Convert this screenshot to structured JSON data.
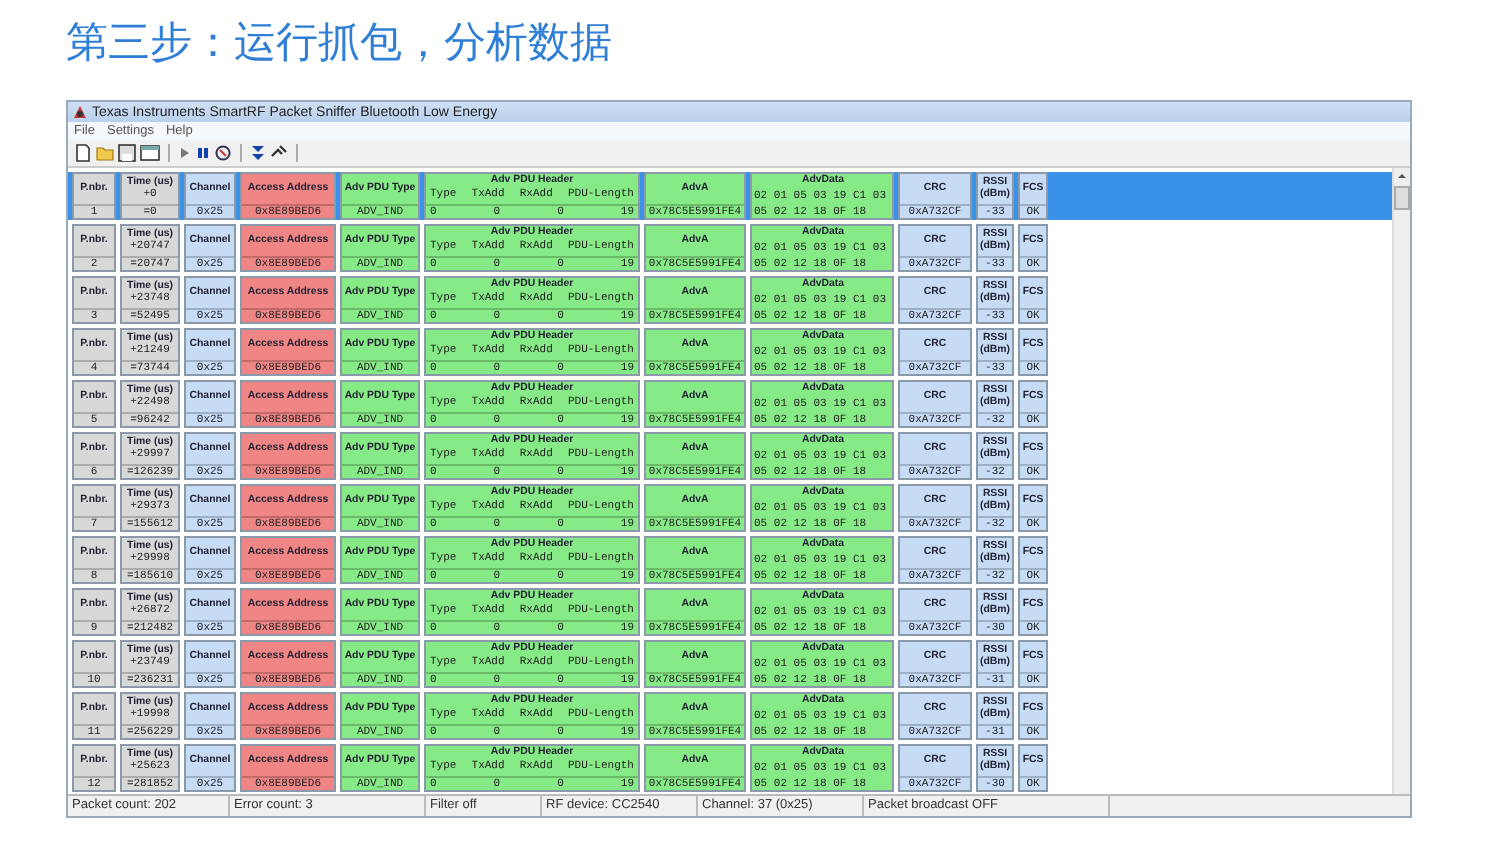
{
  "heading": "第三步：运行抓包，分析数据",
  "window": {
    "title": "Texas Instruments SmartRF Packet Sniffer Bluetooth Low Energy"
  },
  "menu": [
    "File",
    "Settings",
    "Help"
  ],
  "packets": [
    {
      "selected": true,
      "cells": [
        {
          "kind": "meta",
          "header": "P.nbr.",
          "values": [
            "1"
          ]
        },
        {
          "kind": "meta",
          "header": "Time (us)",
          "values": [
            "+0",
            "=0"
          ]
        },
        {
          "kind": "field",
          "header": "Channel",
          "values": [
            "0x25"
          ]
        },
        {
          "kind": "access",
          "header": "Access Address",
          "values": [
            "0x8E89BED6"
          ]
        },
        {
          "kind": "pdu",
          "header": "Adv PDU Type",
          "values": [
            "ADV_IND"
          ]
        },
        {
          "kind": "pdu_table",
          "header": "Adv PDU Header",
          "labels": [
            "Type",
            "TxAdd",
            "RxAdd",
            "PDU-Length"
          ],
          "values": [
            "0",
            "0",
            "0",
            "19"
          ]
        },
        {
          "kind": "pdu",
          "header": "AdvA",
          "values": [
            "0x78C5E5991FE4"
          ]
        },
        {
          "kind": "pdu_block",
          "header": "AdvData",
          "values": [
            "02 01 05 03 19 C1 03",
            "05 02 12 18 0F 18"
          ]
        },
        {
          "kind": "field",
          "header": "CRC",
          "values": [
            "0xA732CF"
          ]
        },
        {
          "kind": "field",
          "header": "RSSI (dBm)",
          "values": [
            "-33"
          ]
        },
        {
          "kind": "field",
          "header": "FCS",
          "values": [
            "OK"
          ]
        }
      ]
    },
    {
      "selected": false,
      "cells": [
        {
          "kind": "meta",
          "header": "P.nbr.",
          "values": [
            "2"
          ]
        },
        {
          "kind": "meta",
          "header": "Time (us)",
          "values": [
            "+20747",
            "=20747"
          ]
        },
        {
          "kind": "field",
          "header": "Channel",
          "values": [
            "0x25"
          ]
        },
        {
          "kind": "access",
          "header": "Access Address",
          "values": [
            "0x8E89BED6"
          ]
        },
        {
          "kind": "pdu",
          "header": "Adv PDU Type",
          "values": [
            "ADV_IND"
          ]
        },
        {
          "kind": "pdu_table",
          "header": "Adv PDU Header",
          "labels": [
            "Type",
            "TxAdd",
            "RxAdd",
            "PDU-Length"
          ],
          "values": [
            "0",
            "0",
            "0",
            "19"
          ]
        },
        {
          "kind": "pdu",
          "header": "AdvA",
          "values": [
            "0x78C5E5991FE4"
          ]
        },
        {
          "kind": "pdu_block",
          "header": "AdvData",
          "values": [
            "02 01 05 03 19 C1 03",
            "05 02 12 18 0F 18"
          ]
        },
        {
          "kind": "field",
          "header": "CRC",
          "values": [
            "0xA732CF"
          ]
        },
        {
          "kind": "field",
          "header": "RSSI (dBm)",
          "values": [
            "-33"
          ]
        },
        {
          "kind": "field",
          "header": "FCS",
          "values": [
            "OK"
          ]
        }
      ]
    },
    {
      "selected": false,
      "cells": [
        {
          "kind": "meta",
          "header": "P.nbr.",
          "values": [
            "3"
          ]
        },
        {
          "kind": "meta",
          "header": "Time (us)",
          "values": [
            "+23748",
            "=52495"
          ]
        },
        {
          "kind": "field",
          "header": "Channel",
          "values": [
            "0x25"
          ]
        },
        {
          "kind": "access",
          "header": "Access Address",
          "values": [
            "0x8E89BED6"
          ]
        },
        {
          "kind": "pdu",
          "header": "Adv PDU Type",
          "values": [
            "ADV_IND"
          ]
        },
        {
          "kind": "pdu_table",
          "header": "Adv PDU Header",
          "labels": [
            "Type",
            "TxAdd",
            "RxAdd",
            "PDU-Length"
          ],
          "values": [
            "0",
            "0",
            "0",
            "19"
          ]
        },
        {
          "kind": "pdu",
          "header": "AdvA",
          "values": [
            "0x78C5E5991FE4"
          ]
        },
        {
          "kind": "pdu_block",
          "header": "AdvData",
          "values": [
            "02 01 05 03 19 C1 03",
            "05 02 12 18 0F 18"
          ]
        },
        {
          "kind": "field",
          "header": "CRC",
          "values": [
            "0xA732CF"
          ]
        },
        {
          "kind": "field",
          "header": "RSSI (dBm)",
          "values": [
            "-33"
          ]
        },
        {
          "kind": "field",
          "header": "FCS",
          "values": [
            "OK"
          ]
        }
      ]
    },
    {
      "selected": false,
      "cells": [
        {
          "kind": "meta",
          "header": "P.nbr.",
          "values": [
            "4"
          ]
        },
        {
          "kind": "meta",
          "header": "Time (us)",
          "values": [
            "+21249",
            "=73744"
          ]
        },
        {
          "kind": "field",
          "header": "Channel",
          "values": [
            "0x25"
          ]
        },
        {
          "kind": "access",
          "header": "Access Address",
          "values": [
            "0x8E89BED6"
          ]
        },
        {
          "kind": "pdu",
          "header": "Adv PDU Type",
          "values": [
            "ADV_IND"
          ]
        },
        {
          "kind": "pdu_table",
          "header": "Adv PDU Header",
          "labels": [
            "Type",
            "TxAdd",
            "RxAdd",
            "PDU-Length"
          ],
          "values": [
            "0",
            "0",
            "0",
            "19"
          ]
        },
        {
          "kind": "pdu",
          "header": "AdvA",
          "values": [
            "0x78C5E5991FE4"
          ]
        },
        {
          "kind": "pdu_block",
          "header": "AdvData",
          "values": [
            "02 01 05 03 19 C1 03",
            "05 02 12 18 0F 18"
          ]
        },
        {
          "kind": "field",
          "header": "CRC",
          "values": [
            "0xA732CF"
          ]
        },
        {
          "kind": "field",
          "header": "RSSI (dBm)",
          "values": [
            "-33"
          ]
        },
        {
          "kind": "field",
          "header": "FCS",
          "values": [
            "OK"
          ]
        }
      ]
    },
    {
      "selected": false,
      "cells": [
        {
          "kind": "meta",
          "header": "P.nbr.",
          "values": [
            "5"
          ]
        },
        {
          "kind": "meta",
          "header": "Time (us)",
          "values": [
            "+22498",
            "=96242"
          ]
        },
        {
          "kind": "field",
          "header": "Channel",
          "values": [
            "0x25"
          ]
        },
        {
          "kind": "access",
          "header": "Access Address",
          "values": [
            "0x8E89BED6"
          ]
        },
        {
          "kind": "pdu",
          "header": "Adv PDU Type",
          "values": [
            "ADV_IND"
          ]
        },
        {
          "kind": "pdu_table",
          "header": "Adv PDU Header",
          "labels": [
            "Type",
            "TxAdd",
            "RxAdd",
            "PDU-Length"
          ],
          "values": [
            "0",
            "0",
            "0",
            "19"
          ]
        },
        {
          "kind": "pdu",
          "header": "AdvA",
          "values": [
            "0x78C5E5991FE4"
          ]
        },
        {
          "kind": "pdu_block",
          "header": "AdvData",
          "values": [
            "02 01 05 03 19 C1 03",
            "05 02 12 18 0F 18"
          ]
        },
        {
          "kind": "field",
          "header": "CRC",
          "values": [
            "0xA732CF"
          ]
        },
        {
          "kind": "field",
          "header": "RSSI (dBm)",
          "values": [
            "-32"
          ]
        },
        {
          "kind": "field",
          "header": "FCS",
          "values": [
            "OK"
          ]
        }
      ]
    },
    {
      "selected": false,
      "cells": [
        {
          "kind": "meta",
          "header": "P.nbr.",
          "values": [
            "6"
          ]
        },
        {
          "kind": "meta",
          "header": "Time (us)",
          "values": [
            "+29997",
            "=126239"
          ]
        },
        {
          "kind": "field",
          "header": "Channel",
          "values": [
            "0x25"
          ]
        },
        {
          "kind": "access",
          "header": "Access Address",
          "values": [
            "0x8E89BED6"
          ]
        },
        {
          "kind": "pdu",
          "header": "Adv PDU Type",
          "values": [
            "ADV_IND"
          ]
        },
        {
          "kind": "pdu_table",
          "header": "Adv PDU Header",
          "labels": [
            "Type",
            "TxAdd",
            "RxAdd",
            "PDU-Length"
          ],
          "values": [
            "0",
            "0",
            "0",
            "19"
          ]
        },
        {
          "kind": "pdu",
          "header": "AdvA",
          "values": [
            "0x78C5E5991FE4"
          ]
        },
        {
          "kind": "pdu_block",
          "header": "AdvData",
          "values": [
            "02 01 05 03 19 C1 03",
            "05 02 12 18 0F 18"
          ]
        },
        {
          "kind": "field",
          "header": "CRC",
          "values": [
            "0xA732CF"
          ]
        },
        {
          "kind": "field",
          "header": "RSSI (dBm)",
          "values": [
            "-32"
          ]
        },
        {
          "kind": "field",
          "header": "FCS",
          "values": [
            "OK"
          ]
        }
      ]
    },
    {
      "selected": false,
      "cells": [
        {
          "kind": "meta",
          "header": "P.nbr.",
          "values": [
            "7"
          ]
        },
        {
          "kind": "meta",
          "header": "Time (us)",
          "values": [
            "+29373",
            "=155612"
          ]
        },
        {
          "kind": "field",
          "header": "Channel",
          "values": [
            "0x25"
          ]
        },
        {
          "kind": "access",
          "header": "Access Address",
          "values": [
            "0x8E89BED6"
          ]
        },
        {
          "kind": "pdu",
          "header": "Adv PDU Type",
          "values": [
            "ADV_IND"
          ]
        },
        {
          "kind": "pdu_table",
          "header": "Adv PDU Header",
          "labels": [
            "Type",
            "TxAdd",
            "RxAdd",
            "PDU-Length"
          ],
          "values": [
            "0",
            "0",
            "0",
            "19"
          ]
        },
        {
          "kind": "pdu",
          "header": "AdvA",
          "values": [
            "0x78C5E5991FE4"
          ]
        },
        {
          "kind": "pdu_block",
          "header": "AdvData",
          "values": [
            "02 01 05 03 19 C1 03",
            "05 02 12 18 0F 18"
          ]
        },
        {
          "kind": "field",
          "header": "CRC",
          "values": [
            "0xA732CF"
          ]
        },
        {
          "kind": "field",
          "header": "RSSI (dBm)",
          "values": [
            "-32"
          ]
        },
        {
          "kind": "field",
          "header": "FCS",
          "values": [
            "OK"
          ]
        }
      ]
    },
    {
      "selected": false,
      "cells": [
        {
          "kind": "meta",
          "header": "P.nbr.",
          "values": [
            "8"
          ]
        },
        {
          "kind": "meta",
          "header": "Time (us)",
          "values": [
            "+29998",
            "=185610"
          ]
        },
        {
          "kind": "field",
          "header": "Channel",
          "values": [
            "0x25"
          ]
        },
        {
          "kind": "access",
          "header": "Access Address",
          "values": [
            "0x8E89BED6"
          ]
        },
        {
          "kind": "pdu",
          "header": "Adv PDU Type",
          "values": [
            "ADV_IND"
          ]
        },
        {
          "kind": "pdu_table",
          "header": "Adv PDU Header",
          "labels": [
            "Type",
            "TxAdd",
            "RxAdd",
            "PDU-Length"
          ],
          "values": [
            "0",
            "0",
            "0",
            "19"
          ]
        },
        {
          "kind": "pdu",
          "header": "AdvA",
          "values": [
            "0x78C5E5991FE4"
          ]
        },
        {
          "kind": "pdu_block",
          "header": "AdvData",
          "values": [
            "02 01 05 03 19 C1 03",
            "05 02 12 18 0F 18"
          ]
        },
        {
          "kind": "field",
          "header": "CRC",
          "values": [
            "0xA732CF"
          ]
        },
        {
          "kind": "field",
          "header": "RSSI (dBm)",
          "values": [
            "-32"
          ]
        },
        {
          "kind": "field",
          "header": "FCS",
          "values": [
            "OK"
          ]
        }
      ]
    },
    {
      "selected": false,
      "cells": [
        {
          "kind": "meta",
          "header": "P.nbr.",
          "values": [
            "9"
          ]
        },
        {
          "kind": "meta",
          "header": "Time (us)",
          "values": [
            "+26872",
            "=212482"
          ]
        },
        {
          "kind": "field",
          "header": "Channel",
          "values": [
            "0x25"
          ]
        },
        {
          "kind": "access",
          "header": "Access Address",
          "values": [
            "0x8E89BED6"
          ]
        },
        {
          "kind": "pdu",
          "header": "Adv PDU Type",
          "values": [
            "ADV_IND"
          ]
        },
        {
          "kind": "pdu_table",
          "header": "Adv PDU Header",
          "labels": [
            "Type",
            "TxAdd",
            "RxAdd",
            "PDU-Length"
          ],
          "values": [
            "0",
            "0",
            "0",
            "19"
          ]
        },
        {
          "kind": "pdu",
          "header": "AdvA",
          "values": [
            "0x78C5E5991FE4"
          ]
        },
        {
          "kind": "pdu_block",
          "header": "AdvData",
          "values": [
            "02 01 05 03 19 C1 03",
            "05 02 12 18 0F 18"
          ]
        },
        {
          "kind": "field",
          "header": "CRC",
          "values": [
            "0xA732CF"
          ]
        },
        {
          "kind": "field",
          "header": "RSSI (dBm)",
          "values": [
            "-30"
          ]
        },
        {
          "kind": "field",
          "header": "FCS",
          "values": [
            "OK"
          ]
        }
      ]
    },
    {
      "selected": false,
      "cells": [
        {
          "kind": "meta",
          "header": "P.nbr.",
          "values": [
            "10"
          ]
        },
        {
          "kind": "meta",
          "header": "Time (us)",
          "values": [
            "+23749",
            "=236231"
          ]
        },
        {
          "kind": "field",
          "header": "Channel",
          "values": [
            "0x25"
          ]
        },
        {
          "kind": "access",
          "header": "Access Address",
          "values": [
            "0x8E89BED6"
          ]
        },
        {
          "kind": "pdu",
          "header": "Adv PDU Type",
          "values": [
            "ADV_IND"
          ]
        },
        {
          "kind": "pdu_table",
          "header": "Adv PDU Header",
          "labels": [
            "Type",
            "TxAdd",
            "RxAdd",
            "PDU-Length"
          ],
          "values": [
            "0",
            "0",
            "0",
            "19"
          ]
        },
        {
          "kind": "pdu",
          "header": "AdvA",
          "values": [
            "0x78C5E5991FE4"
          ]
        },
        {
          "kind": "pdu_block",
          "header": "AdvData",
          "values": [
            "02 01 05 03 19 C1 03",
            "05 02 12 18 0F 18"
          ]
        },
        {
          "kind": "field",
          "header": "CRC",
          "values": [
            "0xA732CF"
          ]
        },
        {
          "kind": "field",
          "header": "RSSI (dBm)",
          "values": [
            "-31"
          ]
        },
        {
          "kind": "field",
          "header": "FCS",
          "values": [
            "OK"
          ]
        }
      ]
    },
    {
      "selected": false,
      "cells": [
        {
          "kind": "meta",
          "header": "P.nbr.",
          "values": [
            "11"
          ]
        },
        {
          "kind": "meta",
          "header": "Time (us)",
          "values": [
            "+19998",
            "=256229"
          ]
        },
        {
          "kind": "field",
          "header": "Channel",
          "values": [
            "0x25"
          ]
        },
        {
          "kind": "access",
          "header": "Access Address",
          "values": [
            "0x8E89BED6"
          ]
        },
        {
          "kind": "pdu",
          "header": "Adv PDU Type",
          "values": [
            "ADV_IND"
          ]
        },
        {
          "kind": "pdu_table",
          "header": "Adv PDU Header",
          "labels": [
            "Type",
            "TxAdd",
            "RxAdd",
            "PDU-Length"
          ],
          "values": [
            "0",
            "0",
            "0",
            "19"
          ]
        },
        {
          "kind": "pdu",
          "header": "AdvA",
          "values": [
            "0x78C5E5991FE4"
          ]
        },
        {
          "kind": "pdu_block",
          "header": "AdvData",
          "values": [
            "02 01 05 03 19 C1 03",
            "05 02 12 18 0F 18"
          ]
        },
        {
          "kind": "field",
          "header": "CRC",
          "values": [
            "0xA732CF"
          ]
        },
        {
          "kind": "field",
          "header": "RSSI (dBm)",
          "values": [
            "-31"
          ]
        },
        {
          "kind": "field",
          "header": "FCS",
          "values": [
            "OK"
          ]
        }
      ]
    },
    {
      "selected": false,
      "cells": [
        {
          "kind": "meta",
          "header": "P.nbr.",
          "values": [
            "12"
          ]
        },
        {
          "kind": "meta",
          "header": "Time (us)",
          "values": [
            "+25623",
            "=281852"
          ]
        },
        {
          "kind": "field",
          "header": "Channel",
          "values": [
            "0x25"
          ]
        },
        {
          "kind": "access",
          "header": "Access Address",
          "values": [
            "0x8E89BED6"
          ]
        },
        {
          "kind": "pdu",
          "header": "Adv PDU Type",
          "values": [
            "ADV_IND"
          ]
        },
        {
          "kind": "pdu_table",
          "header": "Adv PDU Header",
          "labels": [
            "Type",
            "TxAdd",
            "RxAdd",
            "PDU-Length"
          ],
          "values": [
            "0",
            "0",
            "0",
            "19"
          ]
        },
        {
          "kind": "pdu",
          "header": "AdvA",
          "values": [
            "0x78C5E5991FE4"
          ]
        },
        {
          "kind": "pdu_block",
          "header": "AdvData",
          "values": [
            "02 01 05 03 19 C1 03",
            "05 02 12 18 0F 18"
          ]
        },
        {
          "kind": "field",
          "header": "CRC",
          "values": [
            "0xA732CF"
          ]
        },
        {
          "kind": "field",
          "header": "RSSI (dBm)",
          "values": [
            "-30"
          ]
        },
        {
          "kind": "field",
          "header": "FCS",
          "values": [
            "OK"
          ]
        }
      ]
    }
  ],
  "status_bar": [
    "Packet count: 202",
    "Error count: 3",
    "Filter off",
    "RF device: CC2540",
    "Channel: 37 (0x25)",
    "Packet broadcast OFF"
  ]
}
